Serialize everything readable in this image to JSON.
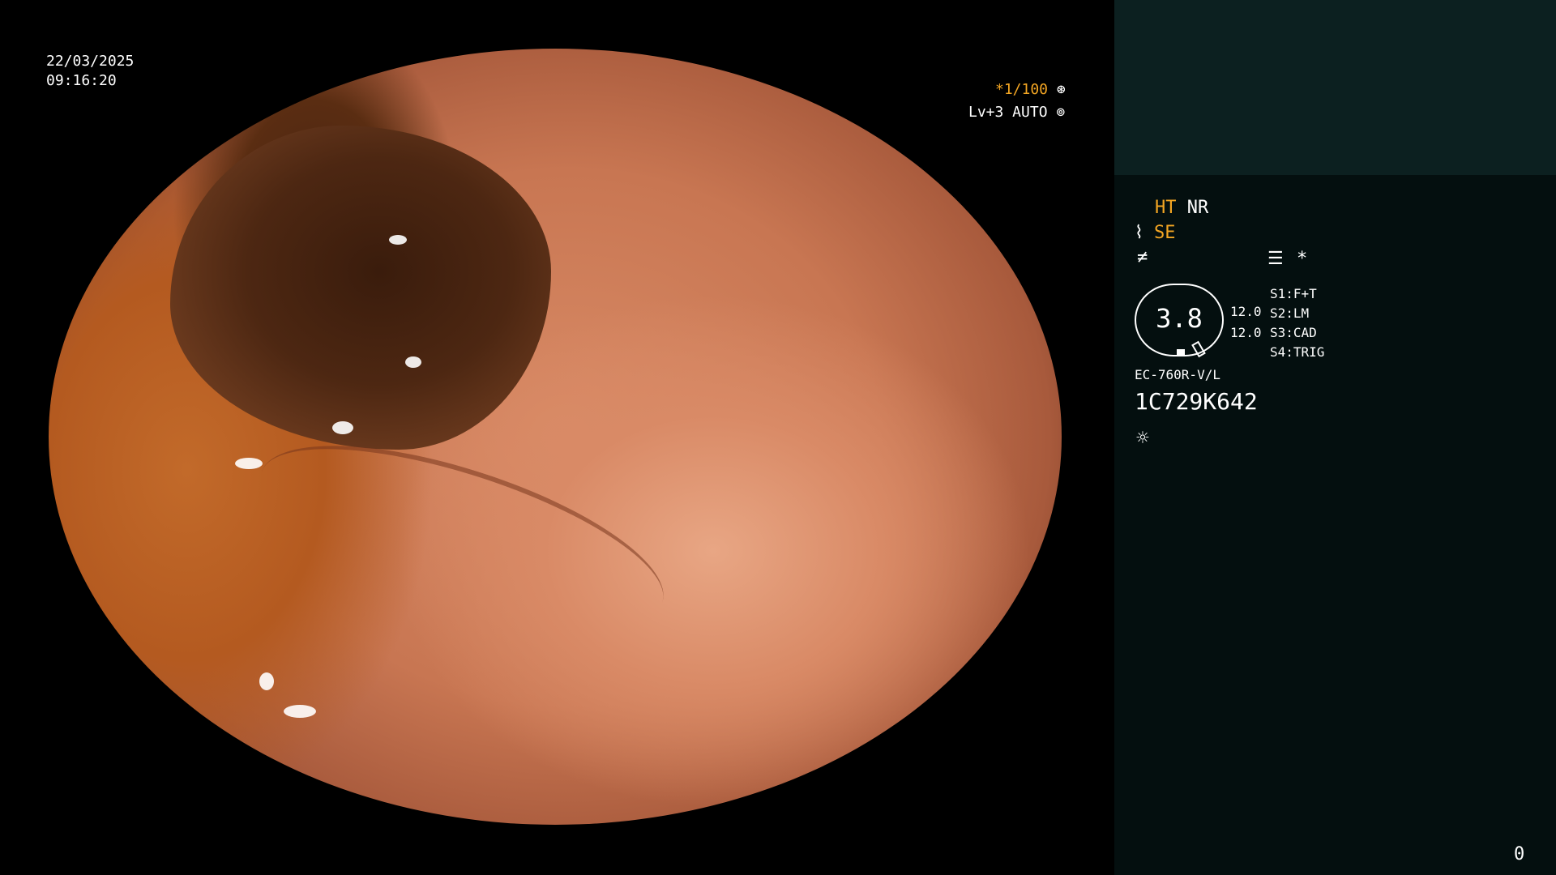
{
  "overlay": {
    "date": "22/03/2025",
    "time": "09:16:20",
    "shutter": "*1/100",
    "shutter_icon": "aperture-icon",
    "light_level": "Lv+3 AUTO",
    "light_icon": "iris-icon"
  },
  "panel": {
    "mode_ht": "HT",
    "mode_nr": "NR",
    "mode_se": "SE",
    "se_icon": "pointer-icon",
    "f_icon": "not-equal-icon",
    "menu_icon": "list-icon",
    "asterisk": "*",
    "gauge_value": "3.8",
    "gauge_top": "12.0",
    "gauge_bottom": "12.0",
    "switches": [
      {
        "key": "S1:",
        "value": "F+T"
      },
      {
        "key": "S2:",
        "value": "LM"
      },
      {
        "key": "S3:",
        "value": "CAD"
      },
      {
        "key": "S4:",
        "value": "TRIG"
      }
    ],
    "model": "EC-760R-V/L",
    "serial": "1C729K642",
    "light_icon": "sun-icon",
    "counter": "0"
  },
  "colors": {
    "accent": "#f4a623",
    "panel_bg": "#040f0f",
    "panel_top_bg": "#0c2020"
  }
}
